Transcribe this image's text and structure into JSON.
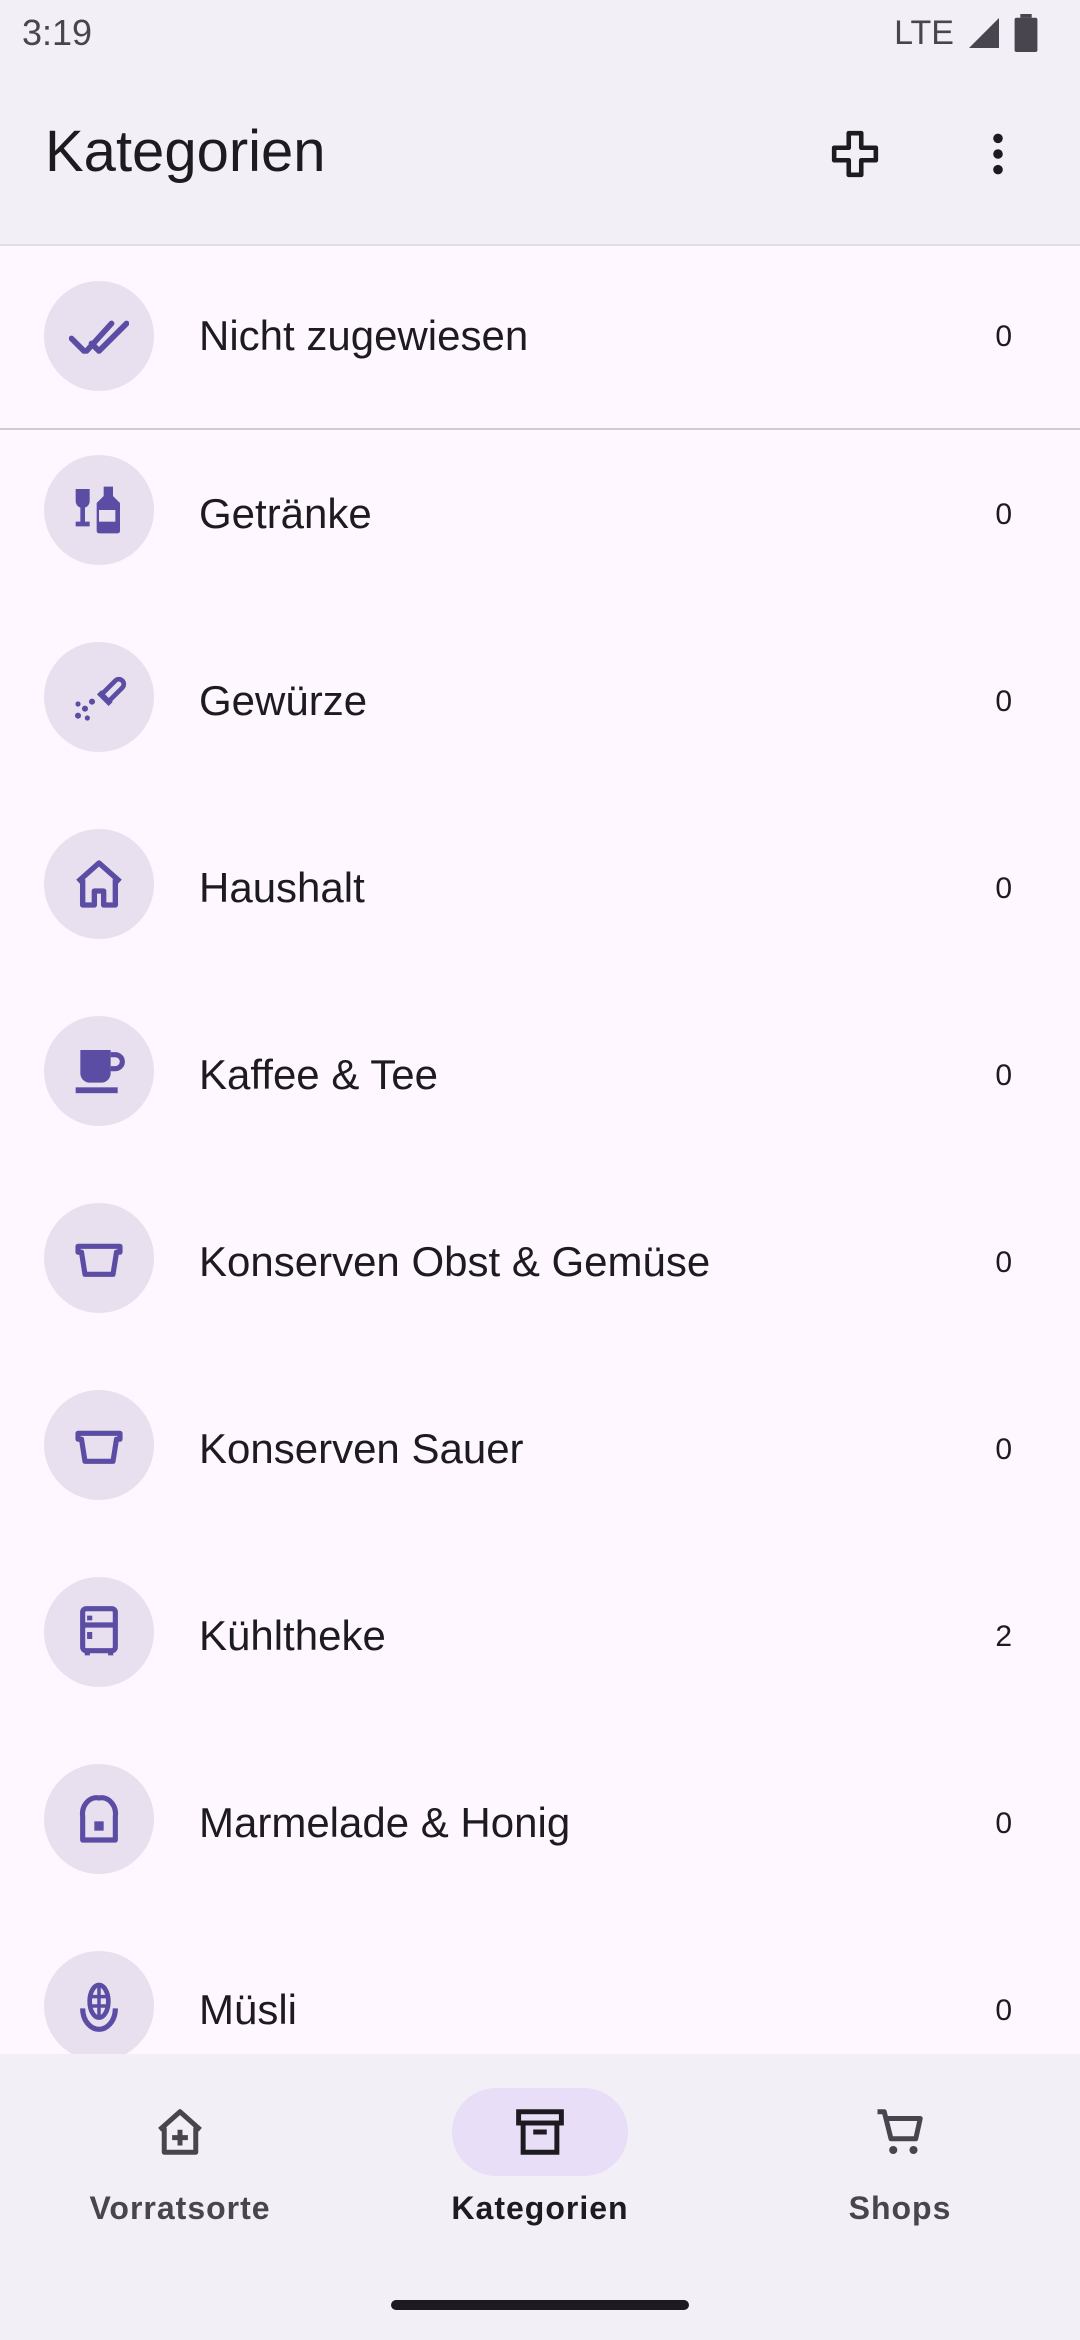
{
  "status": {
    "time": "3:19",
    "network": "LTE"
  },
  "app_bar": {
    "title": "Kategorien"
  },
  "categories": [
    {
      "label": "Nicht zugewiesen",
      "count": "0",
      "icon": "done-all-icon"
    },
    {
      "label": "Getränke",
      "count": "0",
      "icon": "liquor-icon"
    },
    {
      "label": "Gewürze",
      "count": "0",
      "icon": "spice-icon"
    },
    {
      "label": "Haushalt",
      "count": "0",
      "icon": "house-icon"
    },
    {
      "label": "Kaffee & Tee",
      "count": "0",
      "icon": "cup-icon"
    },
    {
      "label": "Konserven Obst & Gemüse",
      "count": "0",
      "icon": "can-icon"
    },
    {
      "label": "Konserven Sauer",
      "count": "0",
      "icon": "can-icon"
    },
    {
      "label": "Kühltheke",
      "count": "2",
      "icon": "fridge-icon"
    },
    {
      "label": "Marmelade & Honig",
      "count": "0",
      "icon": "bread-icon"
    },
    {
      "label": "Müsli",
      "count": "0",
      "icon": "grain-icon"
    }
  ],
  "nav": {
    "items": [
      {
        "label": "Vorratsorte",
        "icon": "home-plus-icon",
        "active": false
      },
      {
        "label": "Kategorien",
        "icon": "archive-icon",
        "active": true
      },
      {
        "label": "Shops",
        "icon": "cart-icon",
        "active": false
      }
    ]
  },
  "colors": {
    "accent": "#5b4da3",
    "avatar_bg": "#e8e0ef",
    "bar_bg": "#f3eff6",
    "active_pill": "#e8def8"
  }
}
